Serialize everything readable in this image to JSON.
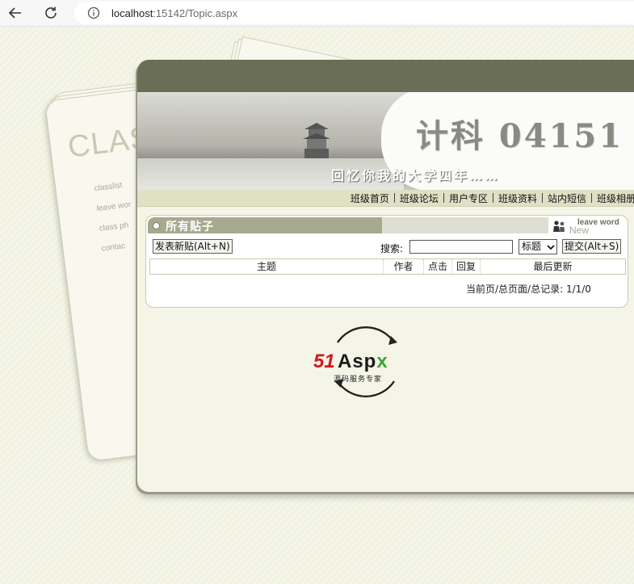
{
  "browser": {
    "url_host": "localhost",
    "url_rest": ":15142/Topic.aspx"
  },
  "decor": {
    "notebook_title": "CLAS",
    "notebook_items": [
      "classlist",
      "leave wor",
      "class ph",
      "contac"
    ]
  },
  "banner": {
    "title": "计科 04151",
    "slogan": "回忆你我的大学四年……"
  },
  "nav": {
    "items": [
      "班级首页",
      "班级论坛",
      "用户专区",
      "班级资料",
      "站内短信",
      "班级相册"
    ]
  },
  "topics": {
    "section_title": "所有贴子",
    "leave_word": "leave word",
    "leave_new": "New",
    "new_post_button": "发表新贴(Alt+N)",
    "search_label": "搜索:",
    "search_value": "",
    "search_field_selected": "标题",
    "submit_button": "提交(Alt+S)",
    "columns": [
      "主题",
      "作者",
      "点击",
      "回复",
      "最后更新"
    ],
    "pager": "当前页/总页面/总记录: 1/1/0"
  },
  "logo": {
    "brand_num": "51",
    "brand_text": "Asp",
    "brand_x": "x",
    "tagline": "源码服务专家"
  },
  "colors": {
    "panel_strip": "#6b6e56",
    "nav_bar": "#dfe0c4",
    "section_header": "#a7a98f",
    "logo_red": "#d4181c",
    "logo_green": "#3aa634"
  }
}
